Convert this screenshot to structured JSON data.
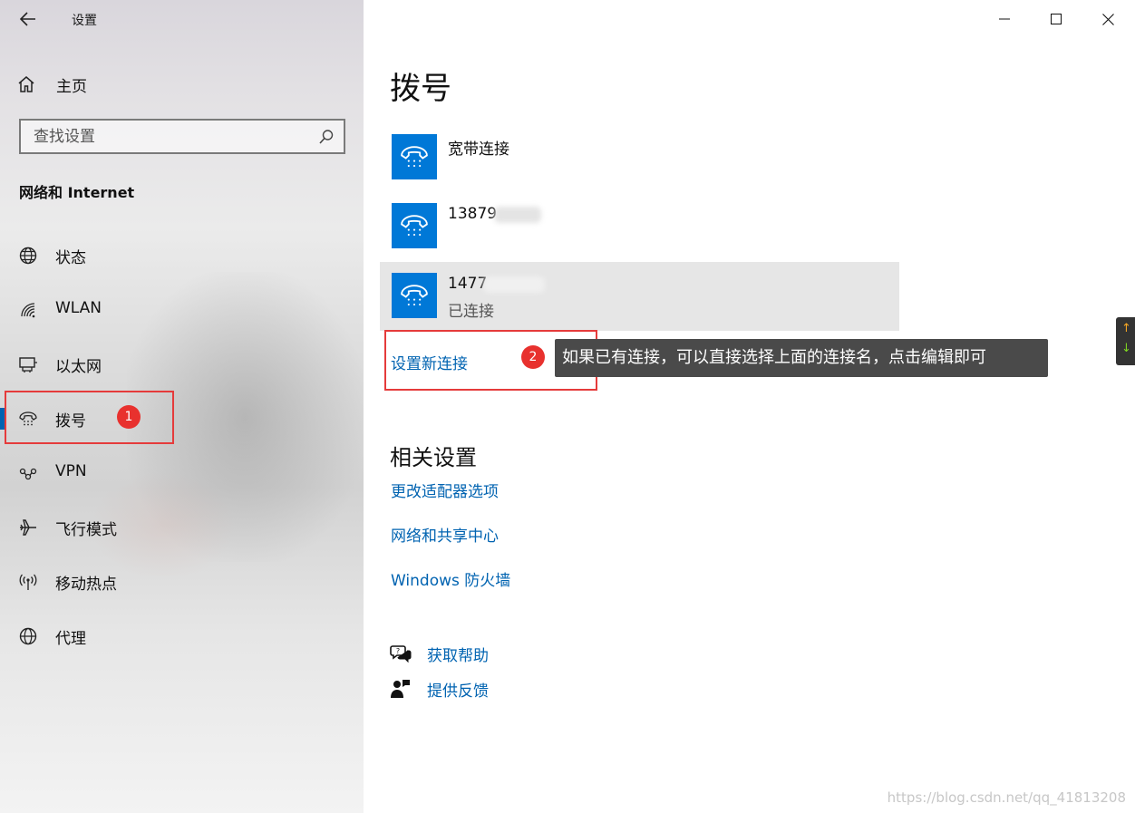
{
  "window": {
    "title": "设置",
    "controls": [
      "minimize",
      "maximize",
      "close"
    ]
  },
  "sidebar": {
    "home_label": "主页",
    "search_placeholder": "查找设置",
    "section_title": "网络和 Internet",
    "items": [
      {
        "label": "状态",
        "icon": "globe-status-icon"
      },
      {
        "label": "WLAN",
        "icon": "wifi-icon"
      },
      {
        "label": "以太网",
        "icon": "ethernet-icon"
      },
      {
        "label": "拨号",
        "icon": "dialup-phone-icon",
        "selected": true
      },
      {
        "label": "VPN",
        "icon": "vpn-icon"
      },
      {
        "label": "飞行模式",
        "icon": "airplane-icon"
      },
      {
        "label": "移动热点",
        "icon": "hotspot-icon"
      },
      {
        "label": "代理",
        "icon": "globe-icon"
      }
    ]
  },
  "main": {
    "title": "拨号",
    "connections": [
      {
        "name": "宽带连接",
        "status": ""
      },
      {
        "name": "13879",
        "status": ""
      },
      {
        "name": "1477",
        "status": "已连接"
      }
    ],
    "setup_new_link": "设置新连接",
    "related_title": "相关设置",
    "related_links": [
      "更改适配器选项",
      "网络和共享中心",
      "Windows 防火墙"
    ],
    "help": [
      {
        "label": "获取帮助",
        "icon": "help-chat-icon"
      },
      {
        "label": "提供反馈",
        "icon": "feedback-icon"
      }
    ]
  },
  "annotations": {
    "badge1": "1",
    "badge2": "2",
    "tooltip": "如果已有连接，可以直接选择上面的连接名，点击编辑即可",
    "color": "#e53b3b"
  },
  "side_widget": {
    "up": "↑",
    "down": "↓"
  },
  "watermark": "https://blog.csdn.net/qq_41813208",
  "colors": {
    "accent": "#0078d7",
    "link": "#0063b1",
    "selected_bar": "#0063b1",
    "tooltip_bg": "#4a4a4a"
  }
}
